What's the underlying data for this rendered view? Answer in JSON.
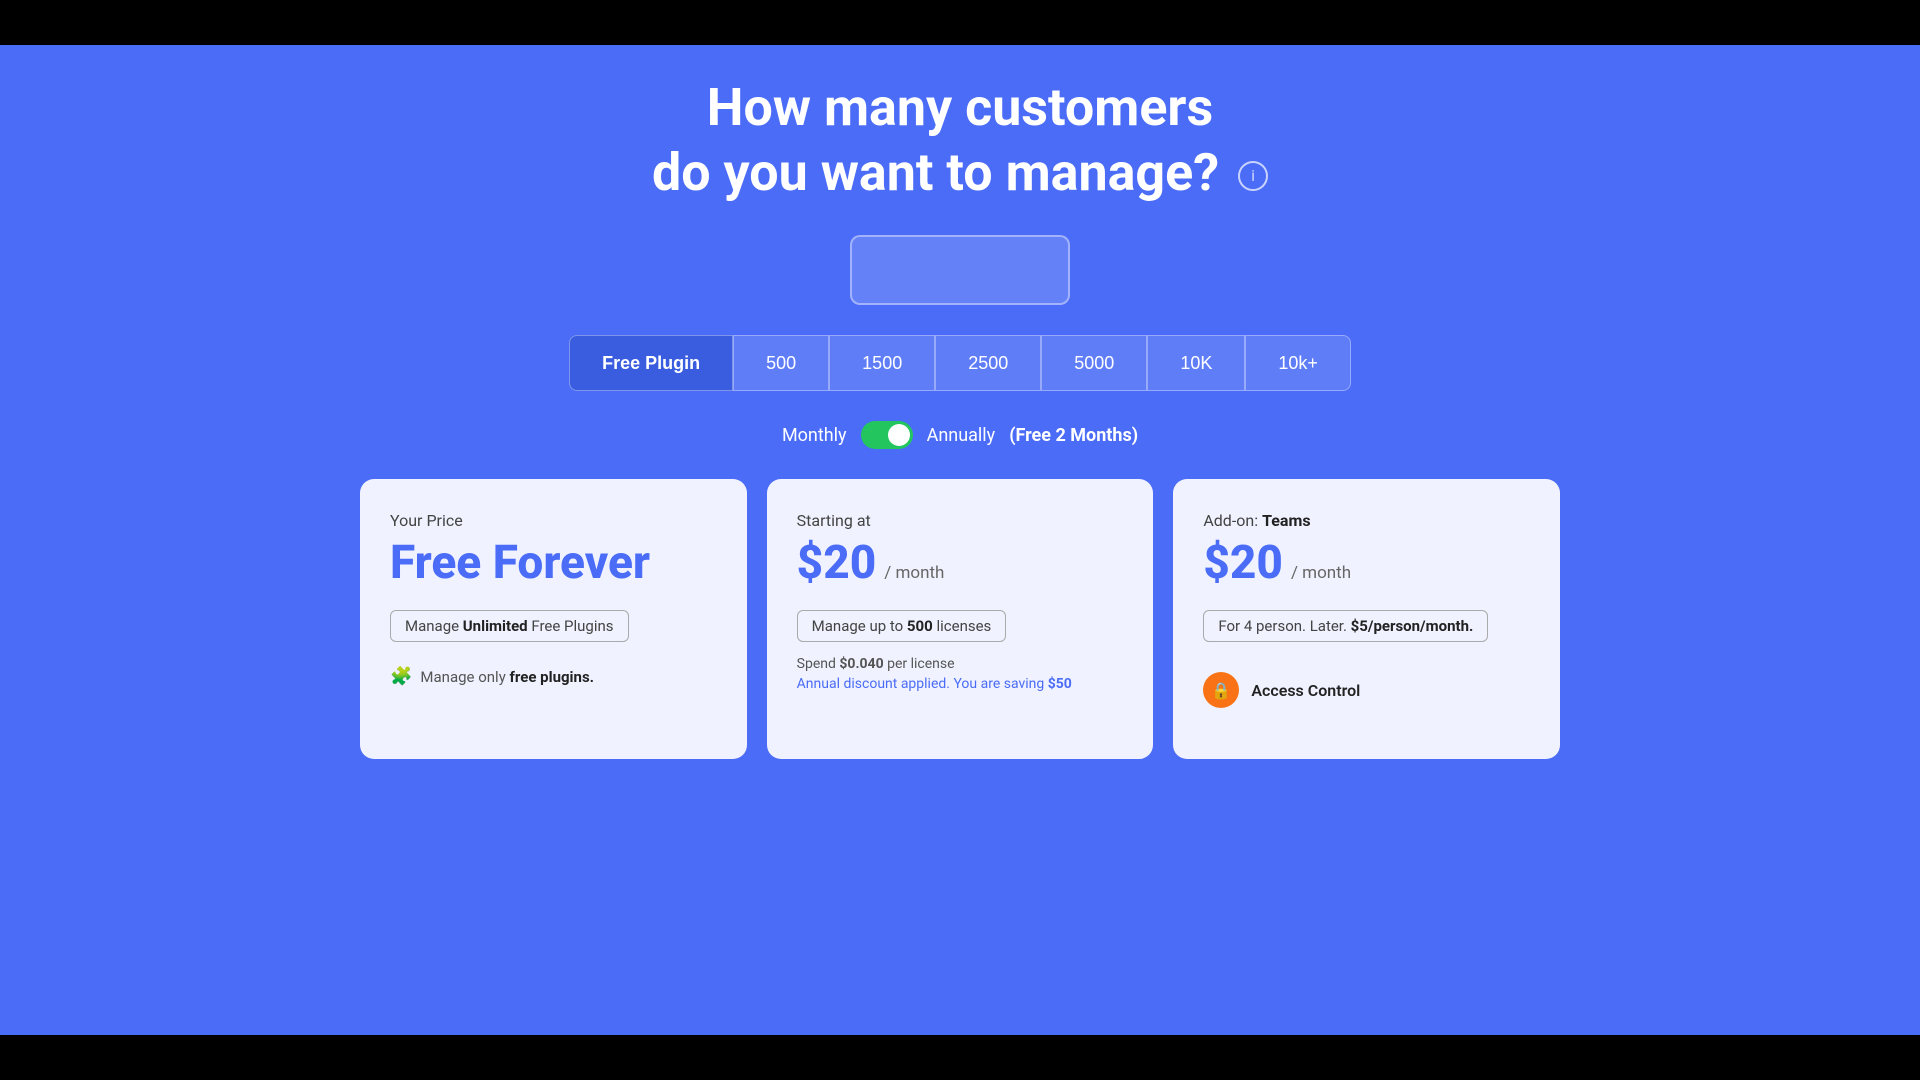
{
  "page": {
    "heading_line1": "How many customers",
    "heading_line2": "do you want to manage?",
    "info_icon_label": "i"
  },
  "tier_buttons": [
    {
      "label": "Free Plugin",
      "active": true
    },
    {
      "label": "500",
      "active": false
    },
    {
      "label": "1500",
      "active": false
    },
    {
      "label": "2500",
      "active": false
    },
    {
      "label": "5000",
      "active": false
    },
    {
      "label": "10K",
      "active": false
    },
    {
      "label": "10k+",
      "active": false
    }
  ],
  "billing": {
    "monthly_label": "Monthly",
    "annually_label": "Annually",
    "free_months": "(Free 2 Months)",
    "toggle_state": "annually"
  },
  "cards": [
    {
      "id": "free",
      "your_price_label": "Your Price",
      "price_text": "Free Forever",
      "manage_text_prefix": "Manage ",
      "manage_text_bold": "Unlimited",
      "manage_text_suffix": " Free Plugins",
      "feature_prefix": "Manage only ",
      "feature_bold": "free plugins.",
      "feature_icon": "🧩"
    },
    {
      "id": "starter",
      "starting_at_label": "Starting at",
      "price_amount": "$20",
      "price_period": "/ month",
      "badge_prefix": "Manage up to ",
      "badge_bold": "500",
      "badge_suffix": " licenses",
      "spend_prefix": "Spend ",
      "spend_bold": "$0.040",
      "spend_suffix": " per license",
      "saving_prefix": "Annual discount applied. You are saving ",
      "saving_bold": "$50"
    },
    {
      "id": "teams",
      "addon_prefix": "Add-on: ",
      "addon_bold": "Teams",
      "price_amount": "$20",
      "price_period": "/ month",
      "for_persons_prefix": "For 4 person. Later. ",
      "for_persons_bold": "$5/person/month.",
      "access_label": "Access Control",
      "access_icon_char": "🔒"
    }
  ]
}
